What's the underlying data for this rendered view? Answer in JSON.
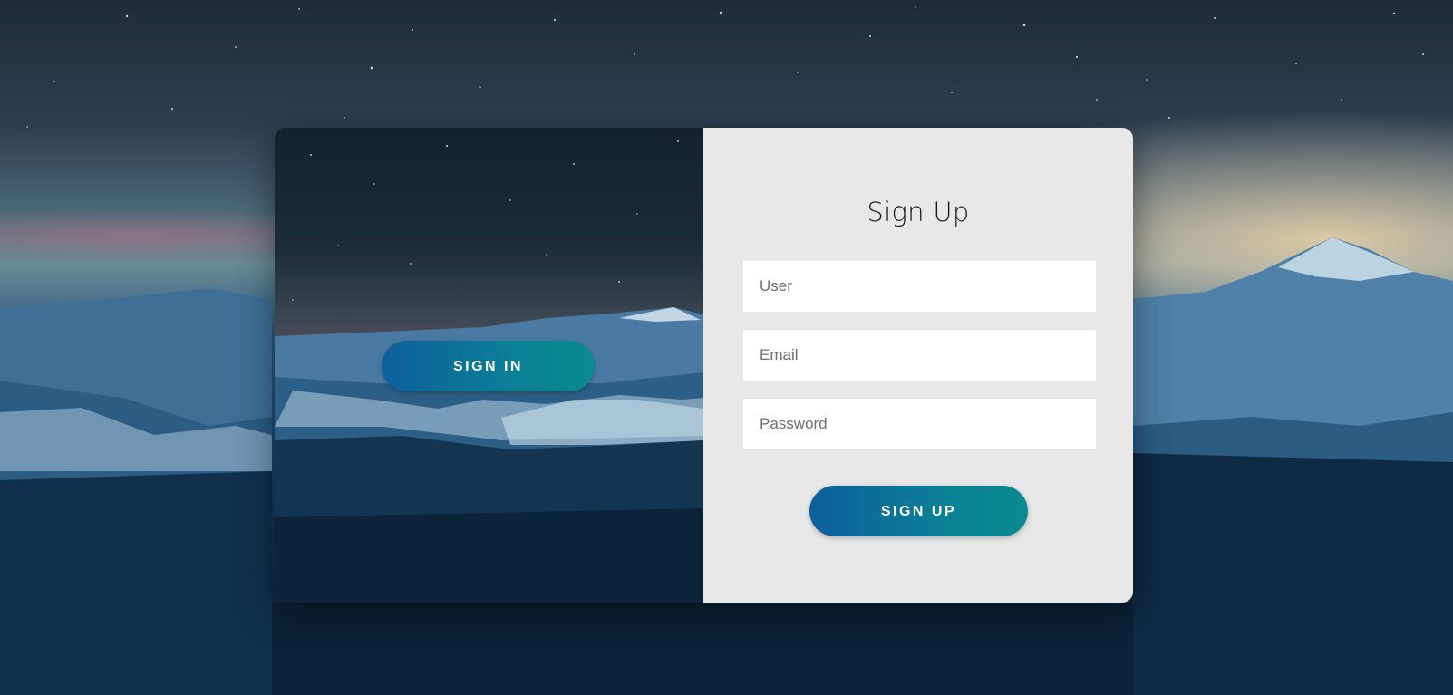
{
  "signin_panel": {
    "signin_button_label": "SIGN IN"
  },
  "signup_form": {
    "title": "Sign Up",
    "fields": {
      "user_placeholder": "User",
      "email_placeholder": "Email",
      "password_placeholder": "Password"
    },
    "submit_label": "SIGN UP"
  },
  "colors": {
    "button_gradient_start": "#0d5f9c",
    "button_gradient_end": "#0a8a90",
    "form_background": "#e8e8e8",
    "input_background": "#ffffff"
  }
}
